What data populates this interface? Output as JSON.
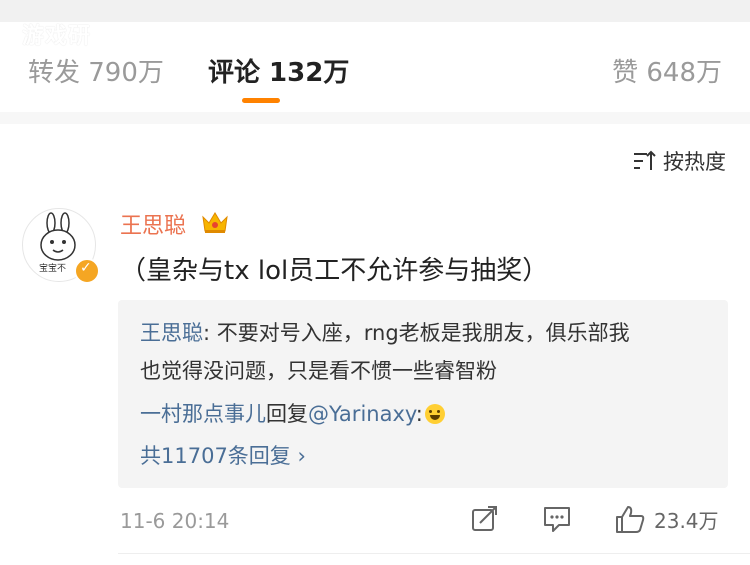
{
  "watermark": "游戏研",
  "tabs": {
    "repost": "转发 790万",
    "comments": "评论 132万",
    "likes": "赞 648万"
  },
  "sort": {
    "label": "按热度"
  },
  "comment": {
    "username": "王思聪",
    "avatar_text": "宝宝不",
    "text": "（皇杂与tx lol员工不允许参与抽奖）",
    "time": "11-6 20:14",
    "like_count": "23.4万"
  },
  "reply": {
    "author": "王思聪",
    "line1_text": ": 不要对号入座，rng老板是我朋友，俱乐部我",
    "line2_text": "也觉得没问题，只是看不惯一些睿智粉",
    "line3_user": "一村那点事儿",
    "line3_mid": "回复",
    "line3_mention": "@Yarinaxy",
    "line3_colon": ":",
    "more_text": "共11707条回复 ›"
  },
  "colors": {
    "accent": "#ff8200",
    "username": "#eb7350",
    "link": "#4a6e96"
  }
}
